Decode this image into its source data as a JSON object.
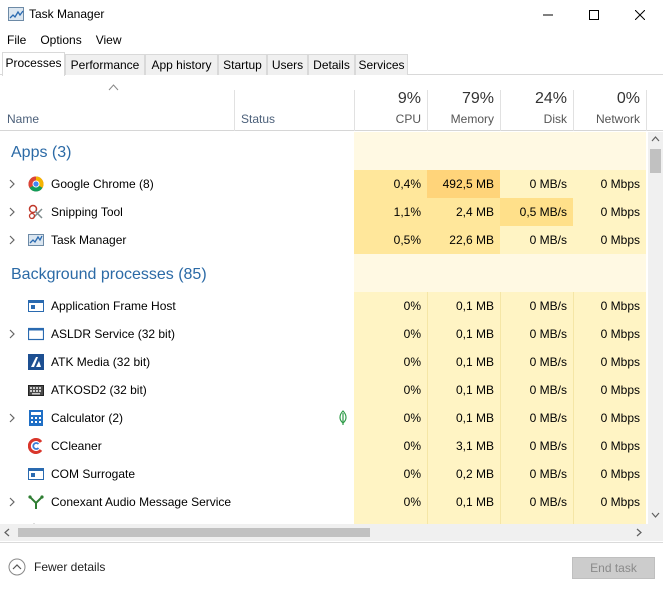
{
  "window": {
    "title": "Task Manager"
  },
  "menu": [
    "File",
    "Options",
    "View"
  ],
  "tabs": [
    "Processes",
    "Performance",
    "App history",
    "Startup",
    "Users",
    "Details",
    "Services"
  ],
  "columns": {
    "name": "Name",
    "status": "Status",
    "cpu": {
      "percent": "9%",
      "label": "CPU"
    },
    "memory": {
      "percent": "79%",
      "label": "Memory"
    },
    "disk": {
      "percent": "24%",
      "label": "Disk"
    },
    "network": {
      "percent": "0%",
      "label": "Network"
    }
  },
  "groups": {
    "apps": "Apps (3)",
    "background": "Background processes (85)"
  },
  "apps": [
    {
      "name": "Google Chrome (8)",
      "icon": "chrome-icon",
      "cpu": "0,4%",
      "memory": "492,5 MB",
      "disk": "0 MB/s",
      "network": "0 Mbps"
    },
    {
      "name": "Snipping Tool",
      "icon": "snipping-tool-icon",
      "cpu": "1,1%",
      "memory": "2,4 MB",
      "disk": "0,5 MB/s",
      "network": "0 Mbps"
    },
    {
      "name": "Task Manager",
      "icon": "task-manager-icon",
      "cpu": "0,5%",
      "memory": "22,6 MB",
      "disk": "0 MB/s",
      "network": "0 Mbps"
    }
  ],
  "background": [
    {
      "name": "Application Frame Host",
      "icon": "window-icon",
      "cpu": "0%",
      "memory": "0,1 MB",
      "disk": "0 MB/s",
      "network": "0 Mbps"
    },
    {
      "name": "ASLDR Service (32 bit)",
      "icon": "window-icon",
      "cpu": "0%",
      "memory": "0,1 MB",
      "disk": "0 MB/s",
      "network": "0 Mbps"
    },
    {
      "name": "ATK Media (32 bit)",
      "icon": "atk-icon",
      "cpu": "0%",
      "memory": "0,1 MB",
      "disk": "0 MB/s",
      "network": "0 Mbps"
    },
    {
      "name": "ATKOSD2 (32 bit)",
      "icon": "keyboard-icon",
      "cpu": "0%",
      "memory": "0,1 MB",
      "disk": "0 MB/s",
      "network": "0 Mbps"
    },
    {
      "name": "Calculator (2)",
      "icon": "calculator-icon",
      "cpu": "0%",
      "memory": "0,1 MB",
      "disk": "0 MB/s",
      "network": "0 Mbps"
    },
    {
      "name": "CCleaner",
      "icon": "ccleaner-icon",
      "cpu": "0%",
      "memory": "3,1 MB",
      "disk": "0 MB/s",
      "network": "0 Mbps"
    },
    {
      "name": "COM Surrogate",
      "icon": "window-icon",
      "cpu": "0%",
      "memory": "0,2 MB",
      "disk": "0 MB/s",
      "network": "0 Mbps"
    },
    {
      "name": "Conexant Audio Message Service",
      "icon": "conexant-icon",
      "cpu": "0%",
      "memory": "0,1 MB",
      "disk": "0 MB/s",
      "network": "0 Mbps"
    }
  ],
  "footer": {
    "fewer_details": "Fewer details",
    "end_task": "End task"
  },
  "colors": {
    "group_label": "#2b6aa6",
    "heat_low": "#fff4c4",
    "heat_mid": "#ffe79b",
    "heat_high": "#ffd47a",
    "heat_header": "#fff9e3"
  }
}
